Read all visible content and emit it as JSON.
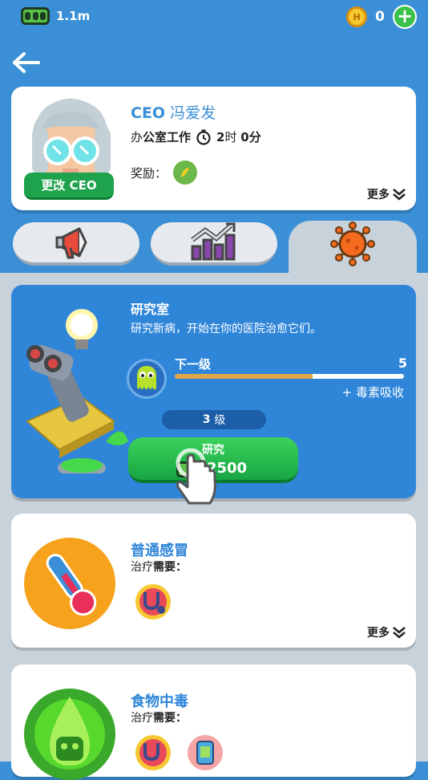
{
  "topbar": {
    "cash": "1.1m",
    "coins": "0",
    "coin_symbol": "H"
  },
  "ceo": {
    "title_prefix": "CEO",
    "name": "冯爱发",
    "job_prefix": "办",
    "job": "公室工作",
    "time_hours": "2",
    "hours_unit": "时",
    "time_minutes": "0分",
    "reward_label": "奖励：",
    "change_button": "更改 CEO",
    "more": "更多"
  },
  "tabs": [
    {
      "name": "marketing",
      "icon": "megaphone-icon"
    },
    {
      "name": "statistics",
      "icon": "chart-icon"
    },
    {
      "name": "research",
      "icon": "virus-icon",
      "active": true
    }
  ],
  "lab": {
    "title": "研究室",
    "description": "研究新病，开始在你的医院治愈它们。",
    "next_level_label": "下一级",
    "next_level_value": "5",
    "progress": 0.6,
    "bonus": "+ 毒素吸收",
    "level_number": "3",
    "level_unit": "级",
    "research_label": "研究",
    "research_cost": "2500"
  },
  "diseases": [
    {
      "name": "普通感冒",
      "need_prefix": "治疗",
      "need": "需要：",
      "icon": "thermometer-icon",
      "color": "#f7a21c",
      "cures": [
        "stethoscope-icon"
      ],
      "more": "更多"
    },
    {
      "name": "食物中毒",
      "need_prefix": "治疗",
      "need": "需要：",
      "icon": "poison-drop-icon",
      "color": "#57d82c",
      "cures": [
        "stethoscope-icon",
        "iv-bag-icon"
      ]
    }
  ],
  "colors": {
    "accent": "#2f86d9",
    "background": "#3a8fd6",
    "panel": "#c8d2db",
    "button_green": "#1ea24c"
  }
}
